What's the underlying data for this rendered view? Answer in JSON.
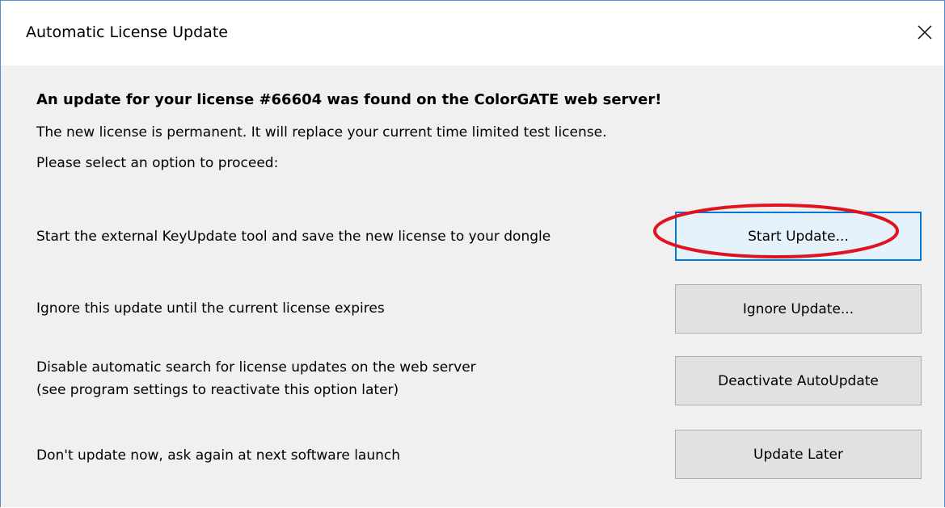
{
  "window": {
    "title": "Automatic License Update"
  },
  "message": {
    "headline": "An update for your license #66604 was found on the ColorGATE web server!",
    "line1": "The new license is permanent. It will replace your current time limited test license.",
    "line2": "Please select an option to proceed:"
  },
  "options": [
    {
      "description": "Start the external KeyUpdate tool and save the new license to your dongle",
      "button": "Start Update..."
    },
    {
      "description": "Ignore this update until the current license expires",
      "button": "Ignore Update..."
    },
    {
      "description_line1": "Disable automatic search for license updates on the web server",
      "description_line2": "(see program settings to reactivate this option later)",
      "button": "Deactivate AutoUpdate"
    },
    {
      "description": "Don't update now, ask again at next software launch",
      "button": "Update Later"
    }
  ],
  "icons": {
    "close": "close-icon"
  },
  "colors": {
    "annotation": "#e0141e",
    "focus_border": "#0078d7",
    "window_border": "#4f8fd1"
  }
}
